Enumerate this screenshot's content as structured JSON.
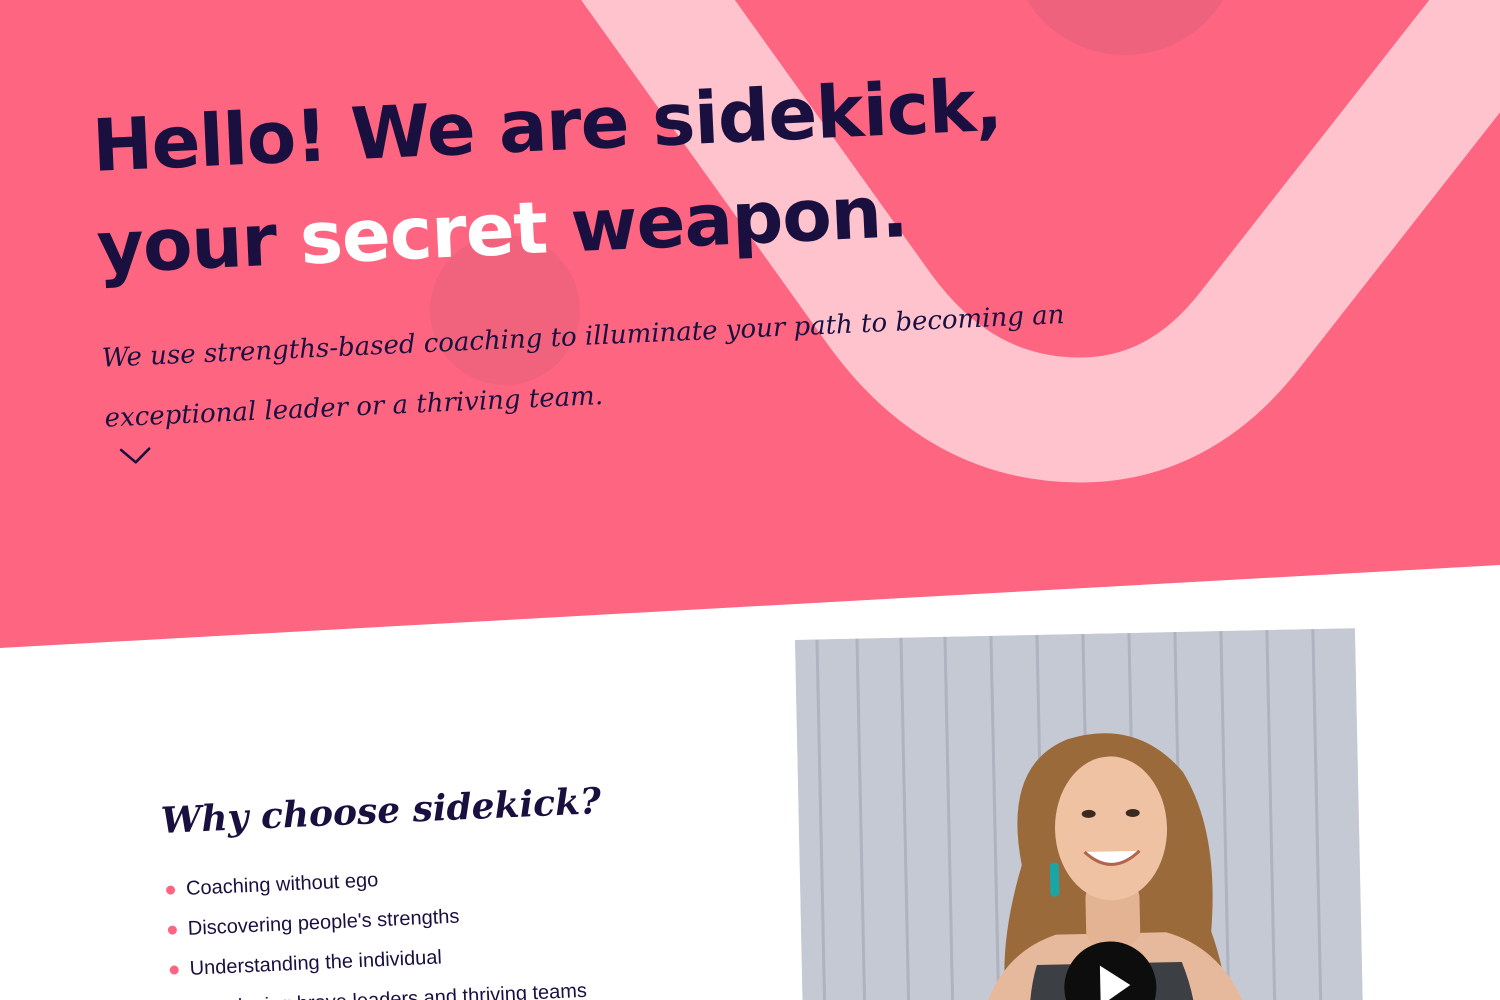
{
  "hero": {
    "headline_line1": "Hello! We are sidekick,",
    "headline_line2_pre": "your ",
    "headline_line2_accent": "secret",
    "headline_line2_post": " weapon.",
    "tagline": "We use strengths-based coaching to illuminate your path to becoming an exceptional leader or a thriving team.",
    "scroll_icon": "chevron-down-icon",
    "background_color": "#fd6580",
    "text_color": "#1a1040",
    "accent_text_color": "#ffffff"
  },
  "why": {
    "title": "Why choose sidekick?",
    "items": [
      "Coaching without ego",
      "Discovering people's strengths",
      "Understanding the individual",
      "Developing brave leaders and thriving teams"
    ],
    "bullet_color": "#fd6580"
  },
  "video": {
    "play_icon": "play-icon"
  }
}
